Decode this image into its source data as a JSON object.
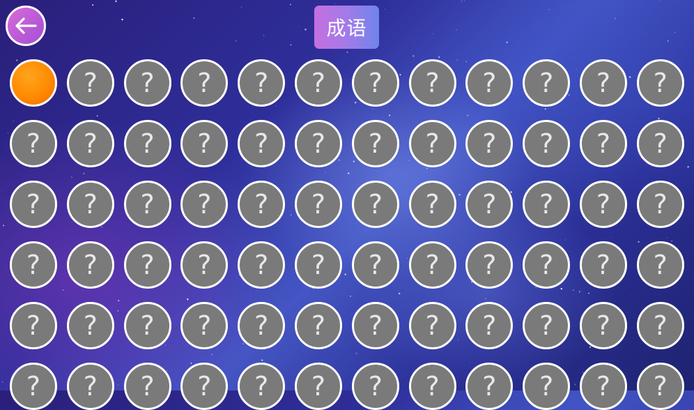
{
  "header": {
    "title": "成语",
    "back_icon": "arrow-left-icon"
  },
  "colors": {
    "unlocked": "#ff8a00",
    "locked": "#7a7a7a",
    "title_gradient_start": "#c66fe0",
    "title_gradient_end": "#6f84ec",
    "back_button": "#c05ad8"
  },
  "levels": {
    "columns": 12,
    "locked_symbol": "?",
    "items": [
      {
        "state": "unlocked"
      },
      {
        "state": "locked"
      },
      {
        "state": "locked"
      },
      {
        "state": "locked"
      },
      {
        "state": "locked"
      },
      {
        "state": "locked"
      },
      {
        "state": "locked"
      },
      {
        "state": "locked"
      },
      {
        "state": "locked"
      },
      {
        "state": "locked"
      },
      {
        "state": "locked"
      },
      {
        "state": "locked"
      },
      {
        "state": "locked"
      },
      {
        "state": "locked"
      },
      {
        "state": "locked"
      },
      {
        "state": "locked"
      },
      {
        "state": "locked"
      },
      {
        "state": "locked"
      },
      {
        "state": "locked"
      },
      {
        "state": "locked"
      },
      {
        "state": "locked"
      },
      {
        "state": "locked"
      },
      {
        "state": "locked"
      },
      {
        "state": "locked"
      },
      {
        "state": "locked"
      },
      {
        "state": "locked"
      },
      {
        "state": "locked"
      },
      {
        "state": "locked"
      },
      {
        "state": "locked"
      },
      {
        "state": "locked"
      },
      {
        "state": "locked"
      },
      {
        "state": "locked"
      },
      {
        "state": "locked"
      },
      {
        "state": "locked"
      },
      {
        "state": "locked"
      },
      {
        "state": "locked"
      },
      {
        "state": "locked"
      },
      {
        "state": "locked"
      },
      {
        "state": "locked"
      },
      {
        "state": "locked"
      },
      {
        "state": "locked"
      },
      {
        "state": "locked"
      },
      {
        "state": "locked"
      },
      {
        "state": "locked"
      },
      {
        "state": "locked"
      },
      {
        "state": "locked"
      },
      {
        "state": "locked"
      },
      {
        "state": "locked"
      },
      {
        "state": "locked"
      },
      {
        "state": "locked"
      },
      {
        "state": "locked"
      },
      {
        "state": "locked"
      },
      {
        "state": "locked"
      },
      {
        "state": "locked"
      },
      {
        "state": "locked"
      },
      {
        "state": "locked"
      },
      {
        "state": "locked"
      },
      {
        "state": "locked"
      },
      {
        "state": "locked"
      },
      {
        "state": "locked"
      },
      {
        "state": "locked"
      },
      {
        "state": "locked"
      },
      {
        "state": "locked"
      },
      {
        "state": "locked"
      },
      {
        "state": "locked"
      },
      {
        "state": "locked"
      },
      {
        "state": "locked"
      },
      {
        "state": "locked"
      },
      {
        "state": "locked"
      },
      {
        "state": "locked"
      },
      {
        "state": "locked"
      },
      {
        "state": "locked"
      }
    ]
  }
}
